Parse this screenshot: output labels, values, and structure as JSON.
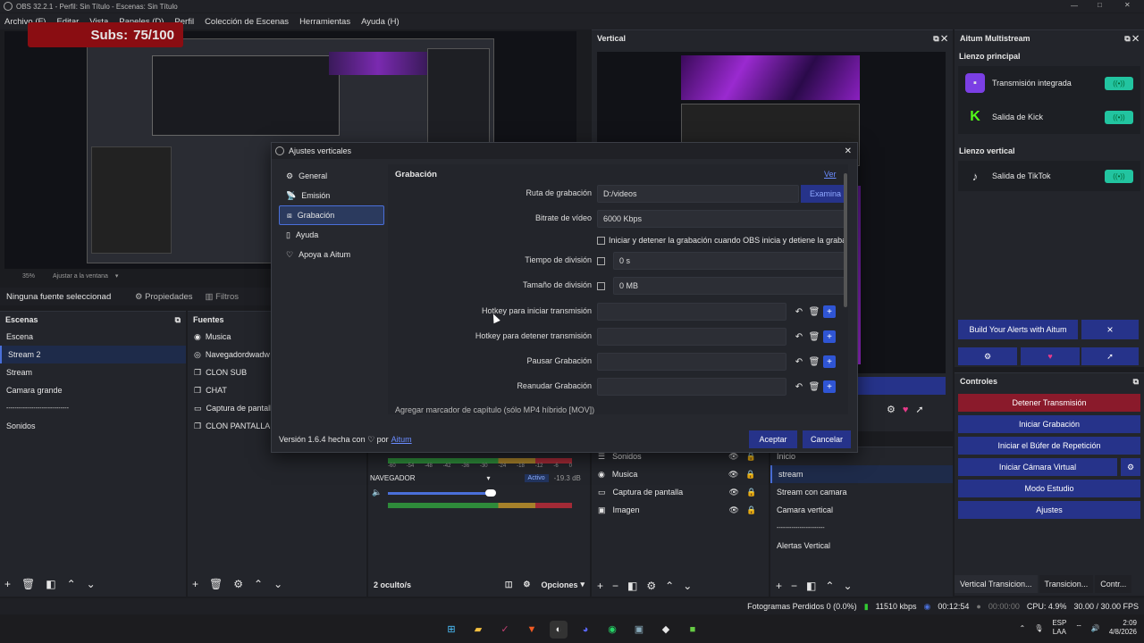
{
  "window": {
    "title": "OBS 32.2.1 - Perfil: Sin Título - Escenas: Sin Título"
  },
  "menu": [
    "Archivo (F)",
    "Editar",
    "Vista",
    "Paneles (D)",
    "Perfil",
    "Colección de Escenas",
    "Herramientas",
    "Ayuda (H)"
  ],
  "subs": {
    "label": "Subs:",
    "value": "75/100"
  },
  "preview": {
    "zoom": "35%",
    "fit": "Ajustar a la ventana"
  },
  "source_toolbar": {
    "none": "Ninguna fuente seleccionad",
    "props": "Propiedades",
    "filters": "Filtros"
  },
  "scenes": {
    "title": "Escenas",
    "items": [
      "Escena",
      "Stream 2",
      "Stream",
      "Camara grande",
      "------------------------------",
      "Sonidos"
    ]
  },
  "sources": {
    "title": "Fuentes",
    "items": [
      "Musica",
      "Navegadordwadw",
      "CLON SUB",
      "CHAT",
      "Captura de pantalla",
      "CLON PANTALLA"
    ]
  },
  "vertical": {
    "title": "Vertical"
  },
  "aitum": {
    "title": "Aitum Multistream",
    "main_canvas": "Lienzo principal",
    "outputs_main": [
      "Transmisión integrada",
      "Salida de Kick"
    ],
    "vertical_canvas": "Lienzo vertical",
    "outputs_vertical": [
      "Salida de TikTok"
    ],
    "alerts_btn": "Build Your Alerts with Aitum",
    "close": "×"
  },
  "controls": {
    "title": "Controles",
    "stop_stream": "Detener Transmisión",
    "start_rec": "Iniciar Grabación",
    "replay": "Iniciar el Búfer de Repetición",
    "vcam": "Iniciar Cámara Virtual",
    "studio": "Modo Estudio",
    "settings": "Ajustes"
  },
  "bottom_tabs": [
    "Vertical Transicion...",
    "Transicion...",
    "Contr..."
  ],
  "mixer": {
    "nav_label": "NAVEGADOR",
    "nav_status": "Activo",
    "nav_db": "-19.3 dB",
    "ticks": [
      "-60",
      "-54",
      "-48",
      "-42",
      "-36",
      "-30",
      "-24",
      "-18",
      "-12",
      "-6",
      "0"
    ],
    "hidden": "2 oculto/s",
    "options": "Opciones"
  },
  "vsources": {
    "items": [
      "Sonidos",
      "Musica",
      "Captura de pantalla",
      "Imagen"
    ]
  },
  "vscenes": {
    "items": [
      "Inicio",
      "stream",
      "Stream con camara",
      "Camara vertical",
      "-----------------------",
      "Alertas Vertical"
    ]
  },
  "dialog": {
    "title": "Ajustes verticales",
    "nav": [
      "General",
      "Emisión",
      "Grabación",
      "Ayuda",
      "Apoya a Aitum"
    ],
    "section": "Grabación",
    "ver_link": "Ver",
    "path_label": "Ruta de grabación",
    "path_value": "D:/videos",
    "browse": "Examina",
    "bitrate_label": "Bitrate de vídeo",
    "bitrate_value": "6000 Kbps",
    "sync_label": "Iniciar y detener la grabación cuando OBS inicia y detiene la graba",
    "split_time_label": "Tiempo de división",
    "split_time_value": "0 s",
    "split_size_label": "Tamaño de división",
    "split_size_value": "0 MB",
    "hotkeys": [
      "Hotkey para iniciar transmisión",
      "Hotkey para detener transmisión",
      "Pausar Grabación",
      "Reanudar Grabación"
    ],
    "cut_label": "Agregar marcador de capítulo (sólo MP4 híbrido [MOV])",
    "version": "Versión 1.6.4 hecha con ♡ por",
    "author": "Aitum",
    "accept": "Aceptar",
    "cancel": "Cancelar"
  },
  "status": {
    "dropped": "Fotogramas Perdidos 0 (0.0%)",
    "kbps": "11510 kbps",
    "stream_time": "00:12:54",
    "rec_time": "00:00:00",
    "cpu": "CPU: 4.9%",
    "fps": "30.00 / 30.00 FPS"
  },
  "taskbar": {
    "lang": "ESP",
    "region": "LAA",
    "time": "2:09",
    "date": "4/8/2026"
  },
  "colors": {
    "accent": "#2f55d4",
    "toggle": "#22c4a0",
    "stop": "#8a1a2b"
  }
}
